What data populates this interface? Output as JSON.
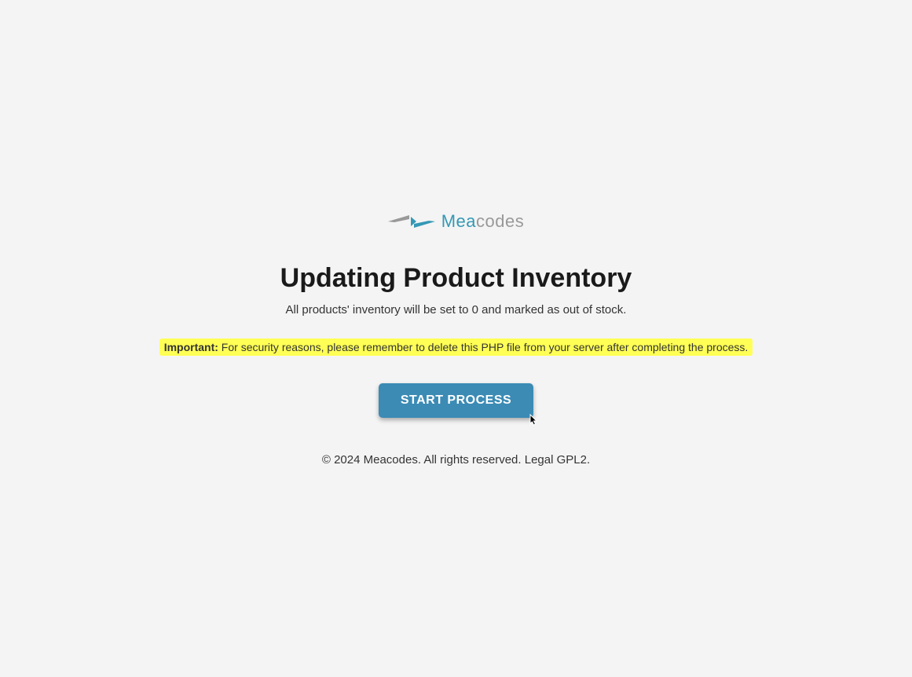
{
  "logo": {
    "brand_first": "Mea",
    "brand_second": "codes"
  },
  "heading": "Updating Product Inventory",
  "subtitle": "All products' inventory will be set to 0 and marked as out of stock.",
  "warning": {
    "label": "Important:",
    "text": " For security reasons, please remember to delete this PHP file from your server after completing the process."
  },
  "button": {
    "label": "START PROCESS"
  },
  "footer": "© 2024 Meacodes. All rights reserved. Legal GPL2."
}
